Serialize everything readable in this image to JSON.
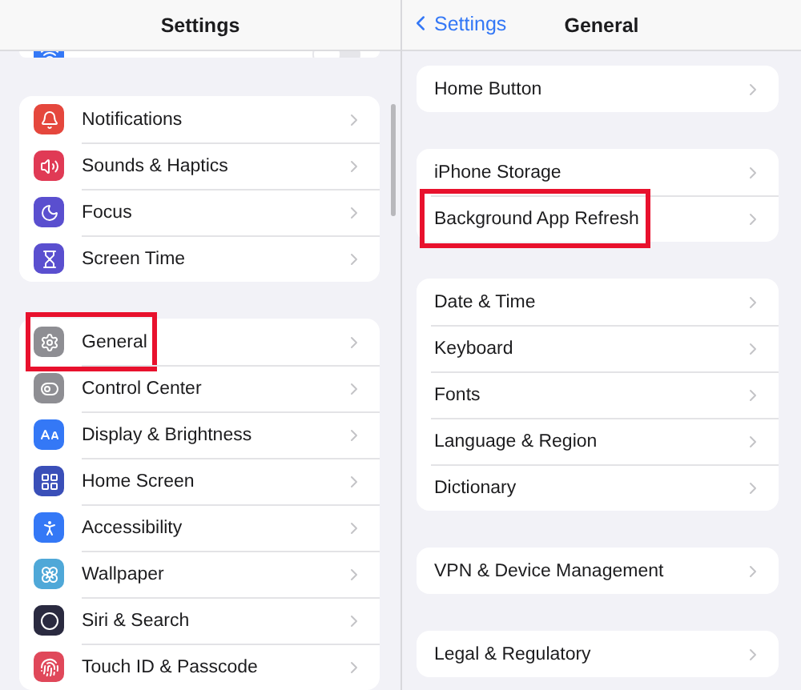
{
  "left_pane": {
    "title": "Settings",
    "partial_row": {
      "color": "#3478f6",
      "toggle": {
        "on": false
      }
    },
    "groups": [
      {
        "items": [
          {
            "label": "Notifications",
            "color": "#e5473d",
            "highlighted": false
          },
          {
            "label": "Sounds & Haptics",
            "color": "#e03a55",
            "highlighted": false
          },
          {
            "label": "Focus",
            "color": "#5a4fcf",
            "highlighted": false
          },
          {
            "label": "Screen Time",
            "color": "#5a4fcf",
            "highlighted": false
          }
        ]
      },
      {
        "items": [
          {
            "label": "General",
            "color": "#8e8e93",
            "highlighted": true
          },
          {
            "label": "Control Center",
            "color": "#8e8e93",
            "highlighted": false
          },
          {
            "label": "Display & Brightness",
            "color": "#3478f6",
            "highlighted": false
          },
          {
            "label": "Home Screen",
            "color": "#3a4fb8",
            "highlighted": false
          },
          {
            "label": "Accessibility",
            "color": "#3478f6",
            "highlighted": false
          },
          {
            "label": "Wallpaper",
            "color": "#4fa8d8",
            "highlighted": false
          },
          {
            "label": "Siri & Search",
            "color": "#2a2a40",
            "highlighted": false
          },
          {
            "label": "Touch ID & Passcode",
            "color": "#e0485a",
            "highlighted": false
          }
        ]
      }
    ]
  },
  "right_pane": {
    "back": "Settings",
    "title": "General",
    "groups": [
      {
        "items": [
          {
            "label": "Home Button",
            "highlighted": false
          }
        ]
      },
      {
        "items": [
          {
            "label": "iPhone Storage",
            "highlighted": false
          },
          {
            "label": "Background App Refresh",
            "highlighted": true
          }
        ]
      },
      {
        "items": [
          {
            "label": "Date & Time",
            "highlighted": false
          },
          {
            "label": "Keyboard",
            "highlighted": false
          },
          {
            "label": "Fonts",
            "highlighted": false
          },
          {
            "label": "Language & Region",
            "highlighted": false
          },
          {
            "label": "Dictionary",
            "highlighted": false
          }
        ]
      },
      {
        "items": [
          {
            "label": "VPN & Device Management",
            "highlighted": false
          }
        ]
      },
      {
        "items": [
          {
            "label": "Legal & Regulatory",
            "highlighted": false
          }
        ]
      }
    ]
  }
}
